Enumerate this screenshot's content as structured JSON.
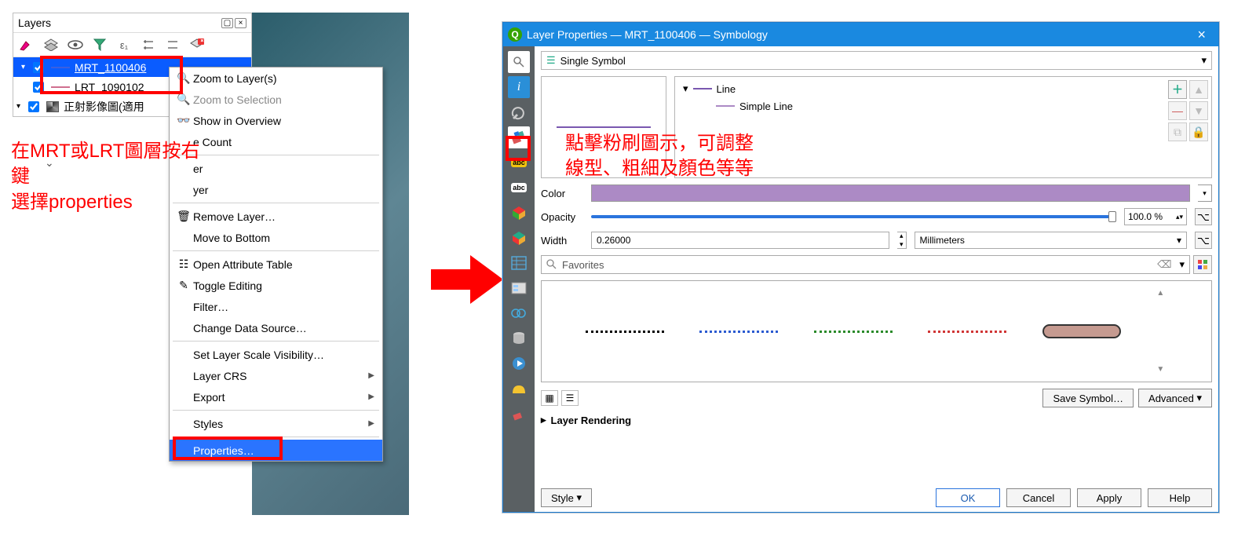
{
  "layers_panel": {
    "title": "Layers",
    "items": [
      {
        "name": "MRT_1100406",
        "color": "#3a5fe0",
        "selected": true
      },
      {
        "name": "LRT_1090102",
        "color": "#d07090",
        "selected": false
      },
      {
        "name": "正射影像圖(適用",
        "color": "#000000",
        "selected": false
      }
    ]
  },
  "context_menu": {
    "items": [
      {
        "label": "Zoom to Layer(s)",
        "icon": "zoom-icon"
      },
      {
        "label": "Zoom to Selection",
        "icon": "zoom-icon",
        "disabled": true
      },
      {
        "label": "Show in Overview",
        "icon": "overview-icon"
      },
      {
        "label": "e Count"
      },
      {
        "label": "er"
      },
      {
        "label": "yer"
      },
      {
        "label": "Remove Layer…",
        "icon": "remove-icon"
      },
      {
        "label": "Move to Bottom"
      },
      {
        "label": "Open Attribute Table",
        "icon": "table-icon"
      },
      {
        "label": "Toggle Editing",
        "icon": "pencil-icon"
      },
      {
        "label": "Filter…"
      },
      {
        "label": "Change Data Source…"
      },
      {
        "label": "Set Layer Scale Visibility…"
      },
      {
        "label": "Layer CRS",
        "submenu": true
      },
      {
        "label": "Export",
        "submenu": true
      },
      {
        "label": "Styles",
        "submenu": true
      },
      {
        "label": "Properties…",
        "highlighted": true
      }
    ]
  },
  "annotations": {
    "left_text": "在MRT或LRT圖層按右\n鍵\n選擇properties",
    "right_text": "點擊粉刷圖示，可調整\n線型、粗細及顏色等等"
  },
  "dialog": {
    "title": "Layer Properties — MRT_1100406 — Symbology",
    "symbol_mode": "Single Symbol",
    "tree": {
      "root": "Line",
      "child": "Simple Line"
    },
    "color": "#ac8ac5",
    "color_label": "Color",
    "opacity_label": "Opacity",
    "opacity": "100.0 %",
    "width_label": "Width",
    "width": "0.26000",
    "width_unit": "Millimeters",
    "favorites_placeholder": "Favorites",
    "styles": [
      "black-dash",
      "blue-dash",
      "green-dash",
      "red-dash",
      "pill"
    ],
    "save_symbol": "Save Symbol…",
    "advanced": "Advanced",
    "layer_rendering": "Layer Rendering",
    "style_btn": "Style",
    "buttons": {
      "ok": "OK",
      "cancel": "Cancel",
      "apply": "Apply",
      "help": "Help"
    }
  }
}
